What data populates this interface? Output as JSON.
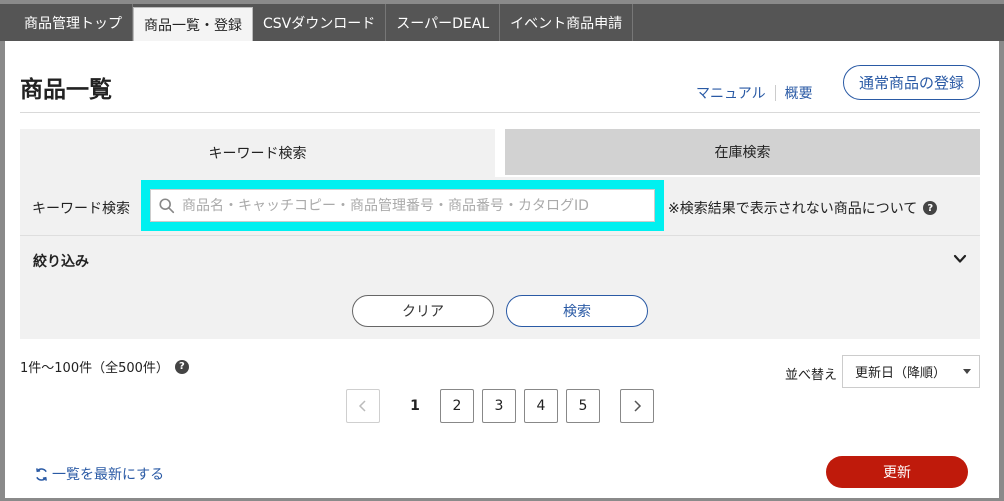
{
  "nav": {
    "items": [
      {
        "label": "商品管理トップ"
      },
      {
        "label": "商品一覧・登録",
        "active": true
      },
      {
        "label": "CSVダウンロード"
      },
      {
        "label": "スーパーDEAL"
      },
      {
        "label": "イベント商品申請"
      }
    ]
  },
  "header": {
    "title": "商品一覧",
    "manual_link": "マニュアル",
    "overview_link": "概要",
    "register_button": "通常商品の登録"
  },
  "search": {
    "tabs": [
      {
        "label": "キーワード検索",
        "active": true
      },
      {
        "label": "在庫検索",
        "active": false
      }
    ],
    "keyword_label": "キーワード検索",
    "keyword_placeholder": "商品名・キャッチコピー・商品管理番号・商品番号・カタログID",
    "keyword_value": "",
    "note": "※検索結果で表示されない商品について",
    "filter_label": "絞り込み",
    "clear_button": "クリア",
    "search_button": "検索"
  },
  "results": {
    "count_text": "1件〜100件（全500件）",
    "sort_label": "並べ替え",
    "sort_selected": "更新日（降順）"
  },
  "pager": {
    "current": "1",
    "pages": [
      "2",
      "3",
      "4",
      "5"
    ]
  },
  "footer": {
    "refresh_link": "一覧を最新にする",
    "update_button": "更新"
  },
  "colors": {
    "accent_blue": "#2a5aa5",
    "update_red": "#bf1a0b",
    "highlight_cyan": "#00f0f0",
    "nav_bg": "#555555"
  }
}
